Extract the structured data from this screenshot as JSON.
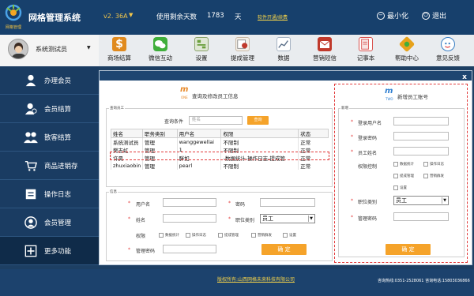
{
  "header": {
    "app_title": "网格管理系统",
    "brand_sub": "网格管理",
    "version": "v2. 36A",
    "days_label": "使用剩余天数",
    "days_value": "1783",
    "days_unit": "天",
    "renew_link": "软件开通/续费",
    "minimize_label": "最小化",
    "exit_label": "退出"
  },
  "user": {
    "name": "系统测试员"
  },
  "toolbar": [
    {
      "label": "商场结算",
      "icon": "dollar-icon",
      "color": "#e08a1e"
    },
    {
      "label": "微信互动",
      "icon": "wechat-icon",
      "color": "#3fae3a"
    },
    {
      "label": "设置",
      "icon": "settings-icon",
      "color": "#6a9f3c"
    },
    {
      "label": "提成管理",
      "icon": "commission-icon",
      "color": "#c0392b"
    },
    {
      "label": "数据",
      "icon": "chart-icon",
      "color": "#8a9bb0"
    },
    {
      "label": "营销短信",
      "icon": "sms-icon",
      "color": "#c0392b"
    },
    {
      "label": "记事本",
      "icon": "notebook-icon",
      "color": "#d9534f"
    },
    {
      "label": "帮助中心",
      "icon": "help-icon",
      "color": "#e6a21b"
    },
    {
      "label": "意见反馈",
      "icon": "feedback-icon",
      "color": "#3a7fc4"
    }
  ],
  "sidebar": [
    {
      "label": "办理会员",
      "icon": "member-add-icon"
    },
    {
      "label": "会员结算",
      "icon": "member-checkout-icon"
    },
    {
      "label": "散客结算",
      "icon": "guest-checkout-icon"
    },
    {
      "label": "商品进销存",
      "icon": "cart-icon"
    },
    {
      "label": "操作日志",
      "icon": "log-icon"
    },
    {
      "label": "会员管理",
      "icon": "member-manage-icon"
    },
    {
      "label": "更多功能",
      "icon": "plus-icon",
      "active": true
    }
  ],
  "dialog": {
    "close_label": "x",
    "left": {
      "logo": "m",
      "logo_sub": "ONE",
      "title": "查询及修改员工信息",
      "query_group": "查询员工",
      "query_label": "查询条件",
      "query_placeholder": "姓名",
      "query_button": "查询",
      "columns": [
        "姓名",
        "职务类别",
        "用户名",
        "权限",
        "状态"
      ],
      "rows": [
        [
          "系统测试员",
          "管理",
          "wanggewellai",
          "不限制",
          "正常"
        ],
        [
          "樊志虹",
          "管理",
          "1",
          "不限制",
          "正常"
        ],
        [
          "许昊",
          "管理",
          "胖如",
          "-数据统计-操作日志-提成管",
          "正常"
        ],
        [
          "zhuxiaobin",
          "管理",
          "pearl",
          "不限制",
          "正常"
        ]
      ],
      "info_group": "信息",
      "username_label": "用户名",
      "password_label": "密码",
      "name_label": "姓名",
      "role_label": "职位类别",
      "role_value": "员工",
      "perm_label": "权限",
      "perm_options": [
        "数据统计",
        "操作日志",
        "提成管理",
        "营销群发",
        "设置"
      ],
      "admin_pwd_label": "管理密码",
      "confirm_button": "确 定"
    },
    "right": {
      "logo": "m",
      "logo_sub": "TWO",
      "title": "新增员工账号",
      "group": "新增",
      "login_user_label": "登录用户名",
      "login_pwd_label": "登录密码",
      "staff_name_label": "员工姓名",
      "perm_label": "权限控制",
      "perm_options": [
        "数据统计",
        "操作日志",
        "提成管理",
        "营销群发",
        "设置"
      ],
      "role_label": "职位类别",
      "role_value": "员工",
      "admin_pwd_label": "管理密码",
      "confirm_button": "确 定"
    }
  },
  "footer": {
    "copyright": "版权所有:山西网格未来科技有限公司",
    "hotline": "咨询热线:0351-2528061  咨询电话:15803036866"
  }
}
